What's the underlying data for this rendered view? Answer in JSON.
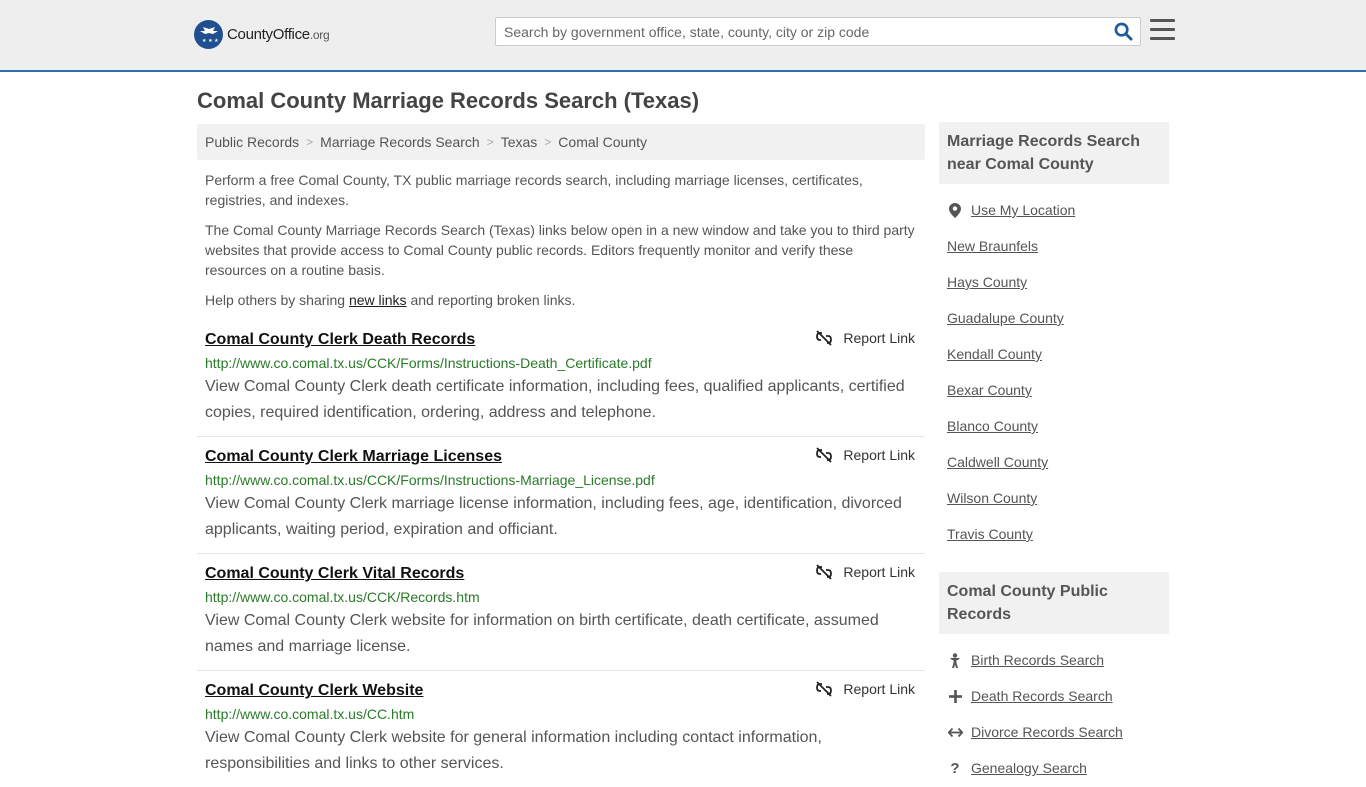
{
  "header": {
    "logo_main": "CountyOffice",
    "logo_suffix": ".org",
    "search_placeholder": "Search by government office, state, county, city or zip code"
  },
  "page": {
    "title": "Comal County Marriage Records Search (Texas)"
  },
  "breadcrumb": [
    "Public Records",
    "Marriage Records Search",
    "Texas",
    "Comal County"
  ],
  "intro": {
    "p1": "Perform a free Comal County, TX public marriage records search, including marriage licenses, certificates, registries, and indexes.",
    "p2": "The Comal County Marriage Records Search (Texas) links below open in a new window and take you to third party websites that provide access to Comal County public records. Editors frequently monitor and verify these resources on a routine basis.",
    "p3_before": "Help others by sharing ",
    "p3_link": "new links",
    "p3_after": " and reporting broken links."
  },
  "report_label": "Report Link",
  "results": [
    {
      "title": "Comal County Clerk Death Records",
      "url": "http://www.co.comal.tx.us/CCK/Forms/Instructions-Death_Certificate.pdf",
      "desc": "View Comal County Clerk death certificate information, including fees, qualified applicants, certified copies, required identification, ordering, address and telephone."
    },
    {
      "title": "Comal County Clerk Marriage Licenses",
      "url": "http://www.co.comal.tx.us/CCK/Forms/Instructions-Marriage_License.pdf",
      "desc": "View Comal County Clerk marriage license information, including fees, age, identification, divorced applicants, waiting period, expiration and officiant."
    },
    {
      "title": "Comal County Clerk Vital Records",
      "url": "http://www.co.comal.tx.us/CCK/Records.htm",
      "desc": "View Comal County Clerk website for information on birth certificate, death certificate, assumed names and marriage license."
    },
    {
      "title": "Comal County Clerk Website",
      "url": "http://www.co.comal.tx.us/CC.htm",
      "desc": "View Comal County Clerk website for general information including contact information, responsibilities and links to other services."
    }
  ],
  "sidebar": {
    "nearby_heading": "Marriage Records Search near Comal County",
    "use_location": "Use My Location",
    "nearby": [
      "New Braunfels",
      "Hays County",
      "Guadalupe County",
      "Kendall County",
      "Bexar County",
      "Blanco County",
      "Caldwell County",
      "Wilson County",
      "Travis County"
    ],
    "public_heading": "Comal County Public Records",
    "public_records": [
      {
        "label": "Birth Records Search",
        "icon": "baby-icon"
      },
      {
        "label": "Death Records Search",
        "icon": "cross-icon"
      },
      {
        "label": "Divorce Records Search",
        "icon": "split-arrows-icon"
      },
      {
        "label": "Genealogy Search",
        "icon": "question-icon"
      }
    ]
  },
  "colors": {
    "accent": "#2c6fb0",
    "url_green": "#2a7a2a",
    "header_bg": "#eeeeee"
  }
}
